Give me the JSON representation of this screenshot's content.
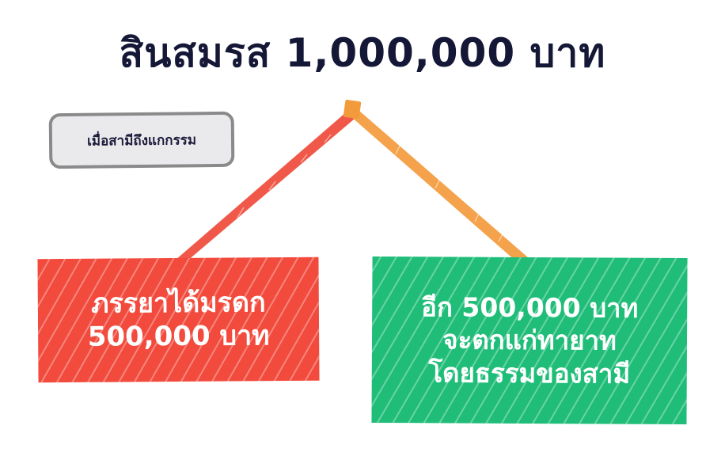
{
  "title": "สินสมรส 1,000,000 บาท",
  "note": {
    "text": "เมื่อสามีถึงแกกรรม"
  },
  "left_box": {
    "lines": [
      "ภรรยาได้มรดก",
      "500,000 บาท"
    ],
    "color": "#f24a3c"
  },
  "right_box": {
    "lines": [
      "อีก 500,000 บาท",
      "จะตกแก่ทายาท",
      "โดยธรรมของสามี"
    ],
    "color": "#1fbd78"
  },
  "colors": {
    "title": "#141736",
    "left_line": "#ef4b3a",
    "right_line": "#f39a3c",
    "knot": "#f39a3c",
    "note_bg": "#eae9ec",
    "note_border": "#8a8a8a"
  }
}
